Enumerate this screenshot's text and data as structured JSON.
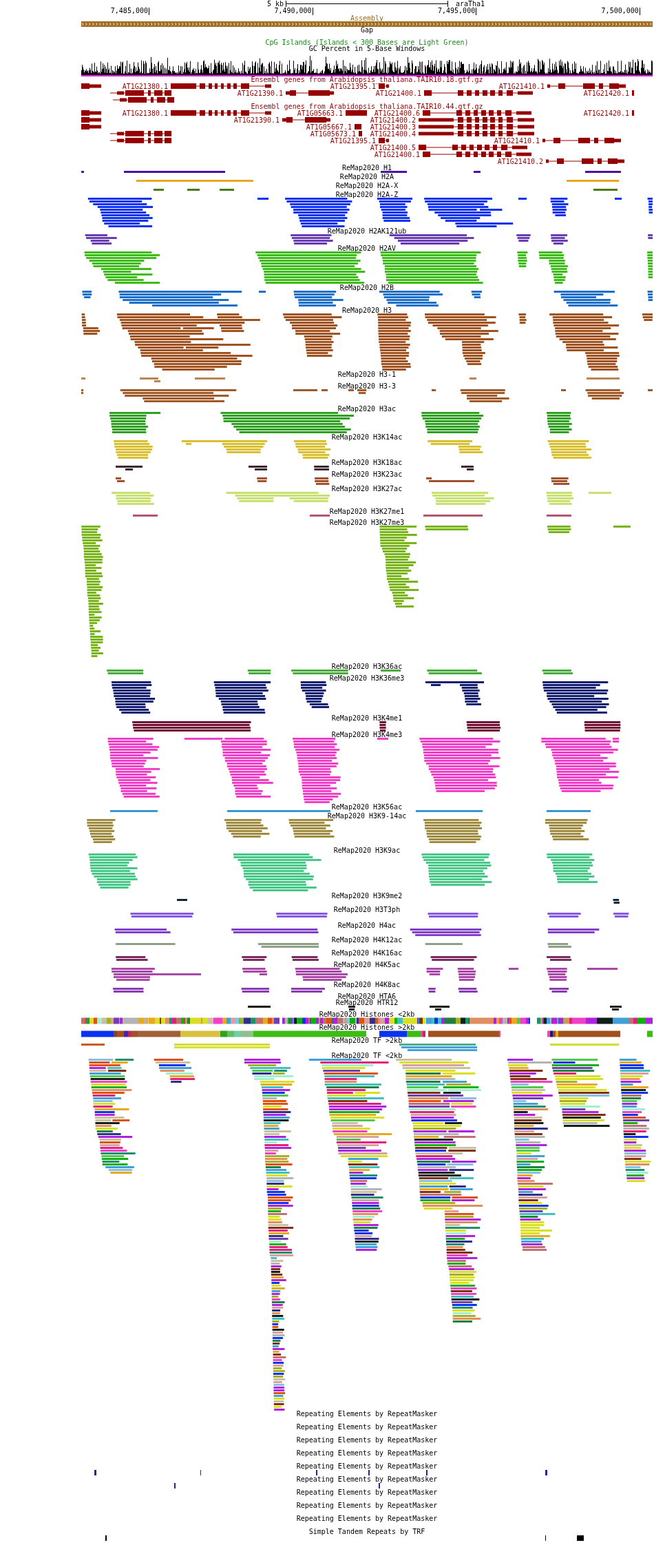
{
  "ruler": {
    "scale_label": "5 kb",
    "assembly_name": "araTha1",
    "positions": [
      "7,485,000",
      "7,490,000",
      "7,495,000",
      "7,500,000"
    ]
  },
  "assembly_track": {
    "title": "Assembly"
  },
  "gap_track": {
    "title": "Gap"
  },
  "cpg_track": {
    "title": "CpG Islands (Islands < 300 Bases are Light Green)"
  },
  "gc_track": {
    "title": "GC Percent in 5-Base Windows"
  },
  "gene_tracks": [
    {
      "title": "Ensembl genes from Arabidopsis_thaliana.TAIR10.18.gtf.gz",
      "genes": [
        {
          "name": "AT1G21380.1"
        },
        {
          "name": "AT1G21395.1"
        },
        {
          "name": "AT1G21410.1"
        },
        {
          "name": "AT1G21390.1"
        },
        {
          "name": "AT1G21400.1"
        },
        {
          "name": "AT1G21420.1"
        }
      ]
    },
    {
      "title": "Ensembl genes from Arabidopsis_thaliana.TAIR10.44.gtf.gz",
      "genes": [
        {
          "name": "AT1G21380.1"
        },
        {
          "name": "AT1G05663.1"
        },
        {
          "name": "AT1G21400.6"
        },
        {
          "name": "AT1G21420.1"
        },
        {
          "name": "AT1G21390.1"
        },
        {
          "name": "AT1G21400.2"
        },
        {
          "name": "AT1G05667.1"
        },
        {
          "name": "AT1G21400.3"
        },
        {
          "name": "AT1G05673.1"
        },
        {
          "name": "AT1G21400.4"
        },
        {
          "name": "AT1G21395.1"
        },
        {
          "name": "AT1G21410.1"
        },
        {
          "name": "AT1G21400.5"
        },
        {
          "name": "AT1G21400.1"
        },
        {
          "name": "AT1G21410.2"
        }
      ]
    }
  ],
  "remap_tracks": [
    {
      "title": "ReMap2020 H1",
      "kind": "solid",
      "color": "#4c10a0"
    },
    {
      "title": "ReMap2020 H2A",
      "kind": "solid",
      "color": "#e8a820"
    },
    {
      "title": "ReMap2020 H2A-X",
      "kind": "solid",
      "color": "#4a7a1a"
    },
    {
      "title": "ReMap2020 H2A-Z",
      "kind": "solid",
      "color": "#0a32f0"
    },
    {
      "title": "ReMap2020 H2AK121ub",
      "kind": "solid",
      "color": "#6a3cb4"
    },
    {
      "title": "ReMap2020 H2AV",
      "kind": "solid",
      "color": "#3cbc14"
    },
    {
      "title": "ReMap2020 H2B",
      "kind": "solid",
      "color": "#1a70c8"
    },
    {
      "title": "ReMap2020 H3",
      "kind": "solid",
      "color": "#a0521e"
    },
    {
      "title": "ReMap2020 H3-1",
      "kind": "solid",
      "color": "#b8864e"
    },
    {
      "title": "ReMap2020 H3-3",
      "kind": "solid",
      "color": "#a05a28"
    },
    {
      "title": "ReMap2020 H3ac",
      "kind": "solid",
      "color": "#30a020"
    },
    {
      "title": "ReMap2020 H3K14ac",
      "kind": "solid",
      "color": "#d8c030"
    },
    {
      "title": "ReMap2020 H3K18ac",
      "kind": "solid",
      "color": "#3c2830"
    },
    {
      "title": "ReMap2020 H3K23ac",
      "kind": "solid",
      "color": "#a0522d"
    },
    {
      "title": "ReMap2020 H3K27ac",
      "kind": "solid",
      "color": "#c8e070"
    },
    {
      "title": "ReMap2020 H3K27me1",
      "kind": "solid",
      "color": "#b05870"
    },
    {
      "title": "ReMap2020 H3K27me3",
      "kind": "solid",
      "color": "#78b414"
    },
    {
      "title": "ReMap2020 H3K36ac",
      "kind": "solid",
      "color": "#4aac3c"
    },
    {
      "title": "ReMap2020 H3K36me3",
      "kind": "solid",
      "color": "#101c70"
    },
    {
      "title": "ReMap2020 H3K4me1",
      "kind": "solid",
      "color": "#700a32"
    },
    {
      "title": "ReMap2020 H3K4me3",
      "kind": "solid",
      "color": "#f040c8"
    },
    {
      "title": "ReMap2020 H3K56ac",
      "kind": "solid",
      "color": "#3898d0"
    },
    {
      "title": "ReMap2020 H3K9-14ac",
      "kind": "solid",
      "color": "#a08c40"
    },
    {
      "title": "ReMap2020 H3K9ac",
      "kind": "solid",
      "color": "#48c888"
    },
    {
      "title": "ReMap2020 H3K9me2",
      "kind": "solid",
      "color": "#102838"
    },
    {
      "title": "ReMap2020 H3T3ph",
      "kind": "solid",
      "color": "#8858e0"
    },
    {
      "title": "ReMap2020 H4ac",
      "kind": "solid",
      "color": "#8040c8"
    },
    {
      "title": "ReMap2020 H4K12ac",
      "kind": "solid",
      "color": "#90a088"
    },
    {
      "title": "ReMap2020 H4K16ac",
      "kind": "solid",
      "color": "#7a2a60"
    },
    {
      "title": "ReMap2020 H4K5ac",
      "kind": "solid",
      "color": "#a848a8"
    },
    {
      "title": "ReMap2020 H4K8ac",
      "kind": "solid",
      "color": "#8a3cb0"
    },
    {
      "title": "ReMap2020 HTA6",
      "kind": "empty"
    },
    {
      "title": "ReMap2020 HTR12",
      "kind": "solid",
      "color": "#101810"
    },
    {
      "title": "ReMap2020 Histones <2kb",
      "kind": "dense"
    },
    {
      "title": "ReMap2020 Histones >2kb",
      "kind": "dense"
    },
    {
      "title": "ReMap2020 TF >2kb",
      "kind": "multicolor"
    },
    {
      "title": "ReMap2020 TF <2kb",
      "kind": "multicolor"
    }
  ],
  "repeat_tracks": [
    {
      "title": "Repeating Elements by RepeatMasker"
    },
    {
      "title": "Repeating Elements by RepeatMasker"
    },
    {
      "title": "Repeating Elements by RepeatMasker"
    },
    {
      "title": "Repeating Elements by RepeatMasker"
    },
    {
      "title": "Repeating Elements by RepeatMasker"
    },
    {
      "title": "Repeating Elements by RepeatMasker"
    },
    {
      "title": "Repeating Elements by RepeatMasker"
    },
    {
      "title": "Repeating Elements by RepeatMasker"
    },
    {
      "title": "Repeating Elements by RepeatMasker"
    }
  ],
  "trf_track": {
    "title": "Simple Tandem Repeats by TRF"
  }
}
